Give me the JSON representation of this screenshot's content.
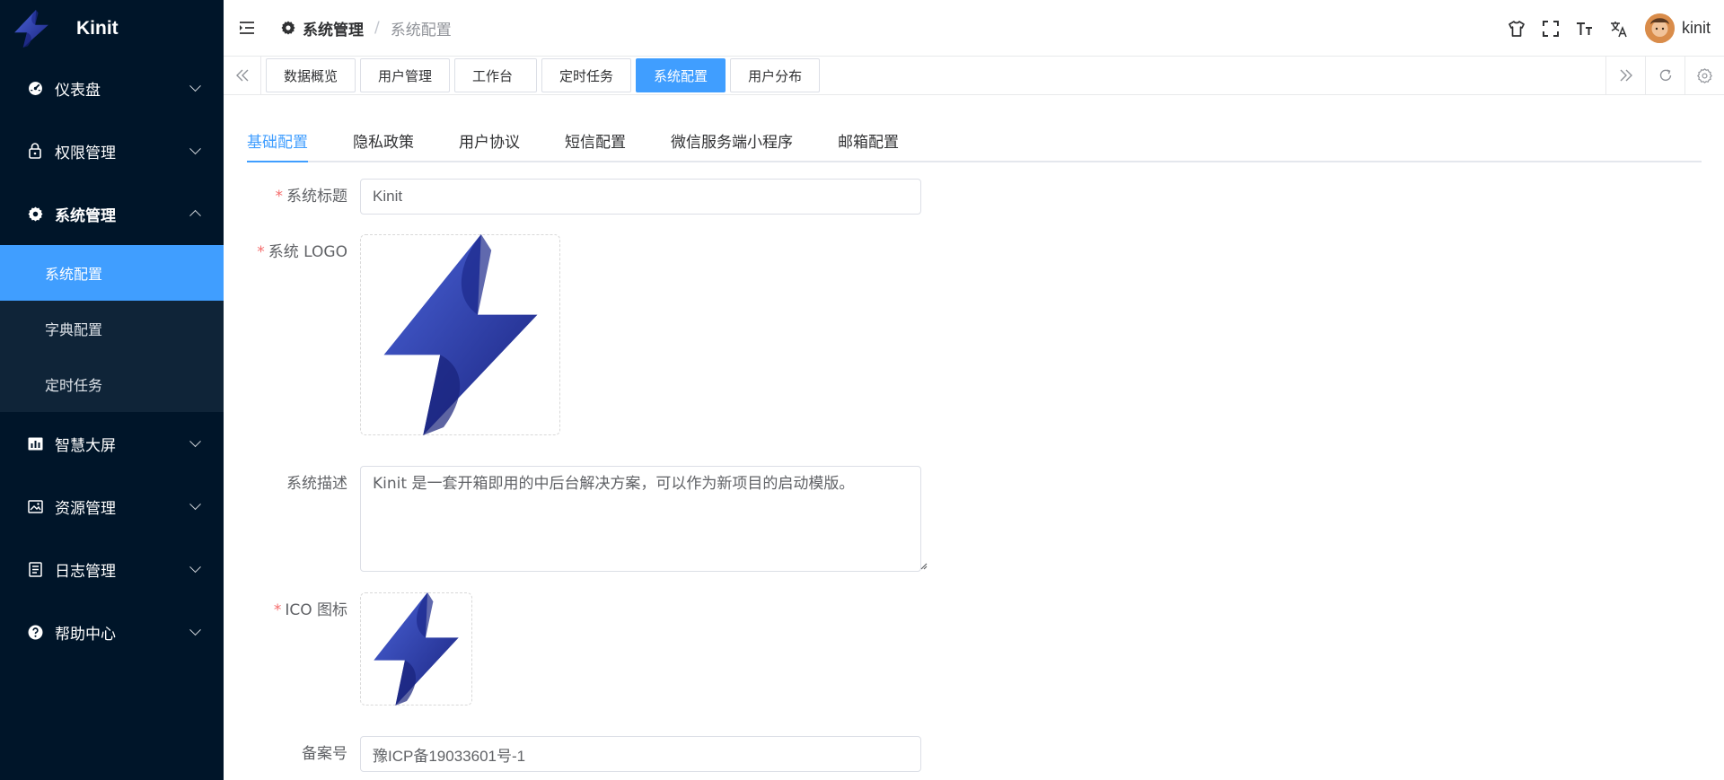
{
  "app": {
    "name": "Kinit"
  },
  "sidebar": {
    "items": [
      {
        "label": "仪表盘",
        "icon": "dashboard-icon",
        "expanded": false
      },
      {
        "label": "权限管理",
        "icon": "lock-icon",
        "expanded": false
      },
      {
        "label": "系统管理",
        "icon": "gear-icon",
        "expanded": true,
        "children": [
          {
            "label": "系统配置",
            "active": true
          },
          {
            "label": "字典配置",
            "active": false
          },
          {
            "label": "定时任务",
            "active": false
          }
        ]
      },
      {
        "label": "智慧大屏",
        "icon": "chart-icon",
        "expanded": false
      },
      {
        "label": "资源管理",
        "icon": "image-icon",
        "expanded": false
      },
      {
        "label": "日志管理",
        "icon": "document-icon",
        "expanded": false
      },
      {
        "label": "帮助中心",
        "icon": "help-icon",
        "expanded": false
      }
    ]
  },
  "header": {
    "breadcrumb": [
      "系统管理",
      "/",
      "系统配置"
    ],
    "username": "kinit",
    "tools": [
      "shirt-icon",
      "fullscreen-icon",
      "font-size-icon",
      "translate-icon"
    ]
  },
  "tags": [
    {
      "label": "数据概览",
      "active": false
    },
    {
      "label": "用户管理",
      "active": false
    },
    {
      "label": "工作台",
      "active": false
    },
    {
      "label": "定时任务",
      "active": false
    },
    {
      "label": "系统配置",
      "active": true
    },
    {
      "label": "用户分布",
      "active": false
    }
  ],
  "tabs": [
    {
      "label": "基础配置",
      "active": true
    },
    {
      "label": "隐私政策",
      "active": false
    },
    {
      "label": "用户协议",
      "active": false
    },
    {
      "label": "短信配置",
      "active": false
    },
    {
      "label": "微信服务端小程序",
      "active": false
    },
    {
      "label": "邮箱配置",
      "active": false
    }
  ],
  "form": {
    "title_label": "系统标题",
    "title_value": "Kinit",
    "logo_label": "系统 LOGO",
    "desc_label": "系统描述",
    "desc_value": "Kinit 是一套开箱即用的中后台解决方案，可以作为新项目的启动模版。",
    "ico_label": "ICO 图标",
    "icp_label": "备案号",
    "icp_value": "豫ICP备19033601号-1"
  },
  "colors": {
    "primary": "#409eff",
    "sidebar_bg": "#001529",
    "required": "#f56c6c"
  }
}
